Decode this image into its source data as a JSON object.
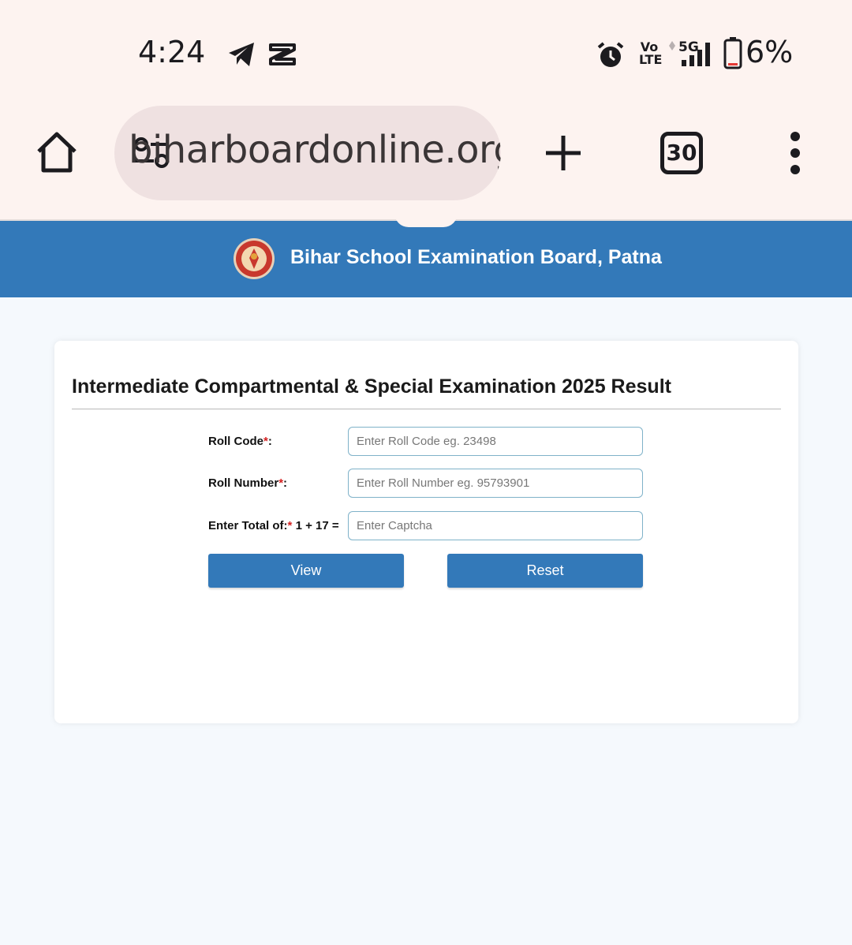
{
  "status_bar": {
    "time": "4:24",
    "volte_top": "Vo",
    "volte_bottom": "LTE",
    "network": "5G",
    "battery": "6%",
    "icons": [
      "telegram-icon",
      "capcut-icon",
      "alarm-icon",
      "signal-icon",
      "battery-icon"
    ]
  },
  "browser": {
    "url": "biharboardonline.org",
    "tab_count": "30",
    "icons": [
      "home-icon",
      "site-settings-icon",
      "new-tab-icon",
      "menu-icon"
    ]
  },
  "site_header": {
    "title": "Bihar School Examination Board, Patna",
    "color": "#3379b9"
  },
  "form": {
    "title": "Intermediate Compartmental & Special Examination 2025 Result",
    "roll_code_label": "Roll Code",
    "roll_code_placeholder": "Enter Roll Code eg. 23498",
    "roll_number_label": "Roll Number",
    "roll_number_placeholder": "Enter Roll Number eg. 95793901",
    "captcha_label": "Enter Total of:",
    "captcha_question": "1 + 17 =",
    "captcha_placeholder": "Enter Captcha",
    "required_mark": "*",
    "label_colon": ":",
    "view_label": "View",
    "reset_label": "Reset"
  }
}
